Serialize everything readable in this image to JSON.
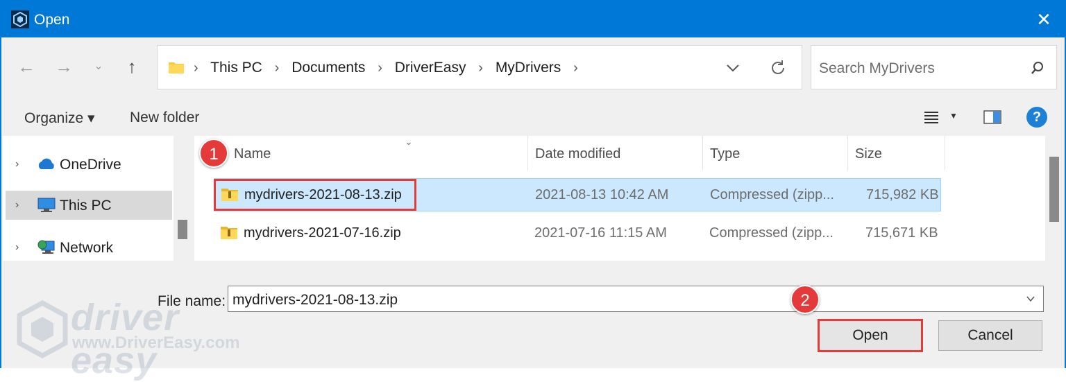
{
  "window": {
    "title": "Open",
    "accent_color": "#0078d7",
    "close_icon": "close-icon"
  },
  "nav": {
    "back_icon": "back-arrow-icon",
    "forward_icon": "forward-arrow-icon",
    "recent_icon": "chevron-down-icon",
    "up_icon": "up-arrow-icon"
  },
  "address": {
    "crumbs": [
      "This PC",
      "Documents",
      "DriverEasy",
      "MyDrivers"
    ],
    "folder_icon": "folder-icon"
  },
  "search": {
    "placeholder": "Search MyDrivers"
  },
  "commands": {
    "organize": "Organize ▾",
    "new_folder": "New folder",
    "help": "?"
  },
  "sidebar": {
    "items": [
      {
        "label": "OneDrive",
        "icon": "cloud-icon"
      },
      {
        "label": "This PC",
        "icon": "computer-icon",
        "selected": true
      },
      {
        "label": "Network",
        "icon": "network-icon"
      }
    ]
  },
  "table": {
    "columns": [
      "Name",
      "Date modified",
      "Type",
      "Size"
    ],
    "rows": [
      {
        "name": "mydrivers-2021-08-13.zip",
        "date": "2021-08-13 10:42 AM",
        "type": "Compressed (zipp...",
        "size": "715,982 KB",
        "selected": true
      },
      {
        "name": "mydrivers-2021-07-16.zip",
        "date": "2021-07-16 11:15 AM",
        "type": "Compressed (zipp...",
        "size": "715,671 KB",
        "selected": false
      }
    ]
  },
  "footer": {
    "file_name_label": "File name:",
    "file_name_value": "mydrivers-2021-08-13.zip",
    "open_label": "Open",
    "cancel_label": "Cancel"
  },
  "annotations": {
    "step1": "1",
    "step2": "2",
    "highlight_color": "#e03c3c"
  },
  "watermark": {
    "brand": "driver easy",
    "url": "www.DriverEasy.com"
  }
}
